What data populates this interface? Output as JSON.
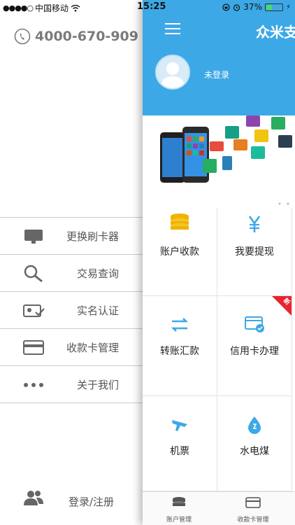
{
  "status": {
    "carrier": "中国移动",
    "time": "15:25",
    "battery": "37%",
    "battery_level": 0.37
  },
  "drawer": {
    "phone": "4000-670-909",
    "menu": [
      {
        "label": "更换刷卡器",
        "icon": "card-reader-icon"
      },
      {
        "label": "交易查询",
        "icon": "search-icon"
      },
      {
        "label": "实名认证",
        "icon": "id-card-verify-icon"
      },
      {
        "label": "收款卡管理",
        "icon": "bank-card-icon"
      },
      {
        "label": "关于我们",
        "icon": "more-dots-icon"
      }
    ],
    "login": "登录/注册"
  },
  "main": {
    "app_name": "众米支",
    "user_status": "未登录",
    "grid": [
      {
        "label": "账户收款",
        "icon": "coins-stack-icon"
      },
      {
        "label": "我要提现",
        "icon": "yen-icon"
      },
      {
        "label": "转账汇款",
        "icon": "transfer-arrows-icon"
      },
      {
        "label": "信用卡办理",
        "icon": "credit-card-icon",
        "badge": "新"
      },
      {
        "label": "机票",
        "icon": "airplane-icon"
      },
      {
        "label": "水电煤",
        "icon": "water-drop-icon"
      }
    ],
    "tabs": [
      {
        "label": "账户管理",
        "icon": "account-stack-icon"
      },
      {
        "label": "收款卡管理",
        "icon": "card-icon"
      }
    ]
  },
  "colors": {
    "header": "#3da8e6",
    "icon_gold": "#f0b400",
    "icon_blue": "#3da8e6",
    "badge": "#e8242c"
  }
}
